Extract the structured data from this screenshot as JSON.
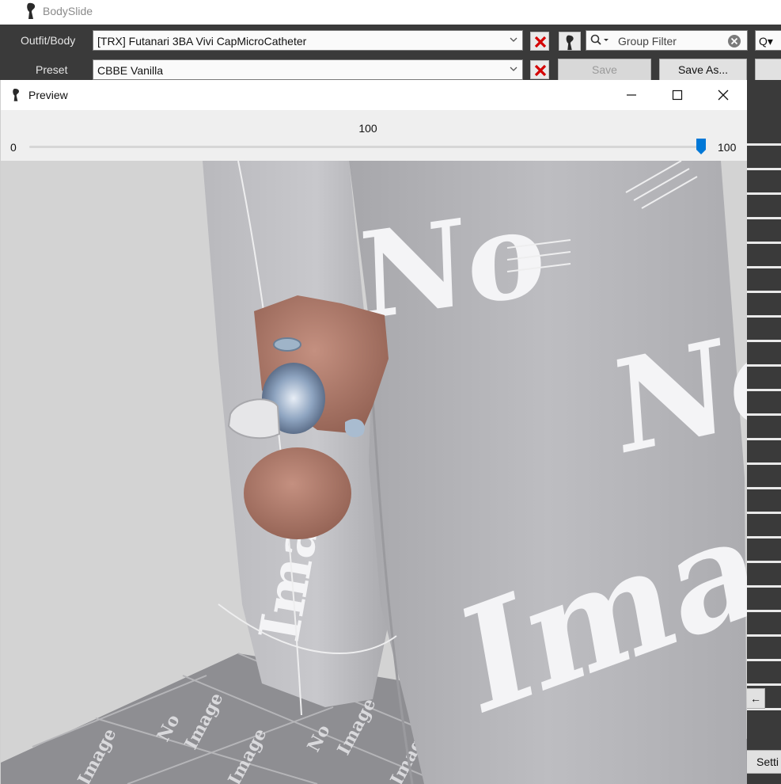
{
  "app": {
    "title": "BodySlide"
  },
  "toolbar": {
    "outfit_label": "Outfit/Body",
    "outfit_value": "[TRX] Futanari 3BA Vivi CapMicroCatheter",
    "preset_label": "Preset",
    "preset_value": "CBBE Vanilla",
    "group_filter_placeholder": "Group Filter",
    "search_partial": "Q▾",
    "save_label": "Save",
    "save_as_label": "Save As..."
  },
  "side": {
    "settings_partial": "Setti",
    "arrow_label": "←"
  },
  "preview": {
    "title": "Preview",
    "slider_value": "100",
    "slider_min": "0",
    "slider_max": "100",
    "slider_level": 1.0,
    "texture_text_1": "No",
    "texture_text_2": "Image"
  },
  "colors": {
    "toolbar_bg": "#3a3a3a",
    "remove_icon": "#d40000",
    "slider_thumb": "#0078d7",
    "viewport_bg": "#d3d3d3",
    "mesh_grey": "#b4b4b8",
    "skin": "#b07a6a"
  }
}
